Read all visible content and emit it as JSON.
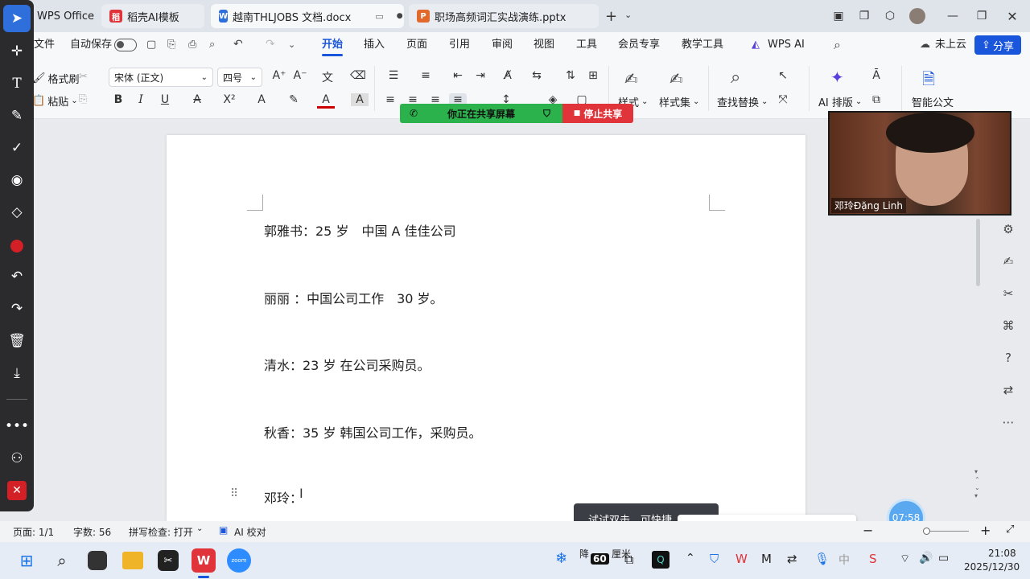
{
  "tabs": [
    {
      "label": "WPS Office",
      "icon": "wps-icon"
    },
    {
      "label": "稻壳AI模板",
      "icon": "docer-icon"
    },
    {
      "label": "越南THLJOBS 文档.docx",
      "icon": "word-icon"
    },
    {
      "label": "职场高频词汇实战演练.pptx",
      "icon": "ppt-icon"
    }
  ],
  "menu": {
    "file": "文件",
    "autosave": "自动保存",
    "items": [
      "开始",
      "插入",
      "页面",
      "引用",
      "审阅",
      "视图",
      "工具",
      "会员专享",
      "教学工具"
    ],
    "wps_ai": "WPS AI",
    "cloud": "未上云",
    "share": "分享"
  },
  "ribbon": {
    "format_painter": "格式刷",
    "paste": "粘贴",
    "font": "宋体 (正文)",
    "size": "四号",
    "styles": "样式",
    "style_set": "样式集",
    "find_replace": "查找替换",
    "ai_layout": "AI 排版",
    "smart_doc": "智能公文"
  },
  "sharing": {
    "status": "你正在共享屏幕",
    "stop": "停止共享"
  },
  "video": {
    "name": "邓玲Đặng Linh"
  },
  "document": {
    "lines": [
      "郭雅书：25 岁　中国 A 佳佳公司",
      "丽丽 ：中国公司工作　30 岁。",
      "清水：23 岁  在公司采购员。",
      "秋香：35 岁  韩国公司工作，采购员。",
      "邓玲："
    ]
  },
  "tooltip": "试试双击，可快捷...",
  "timer": "07:58",
  "status": {
    "page": "页面: 1/1",
    "words": "字数: 56",
    "spell": "拼写检查: 打开",
    "ai_check": "AI 校对"
  },
  "ime": {
    "mode": "中"
  },
  "taskbar": {
    "weather": "降",
    "temp": "60",
    "time": "21:08",
    "date": "2025/12/30",
    "unit": "厘米"
  },
  "colors": {
    "accent": "#1a56db",
    "share_green": "#2bb24c",
    "stop_red": "#e0343a"
  }
}
